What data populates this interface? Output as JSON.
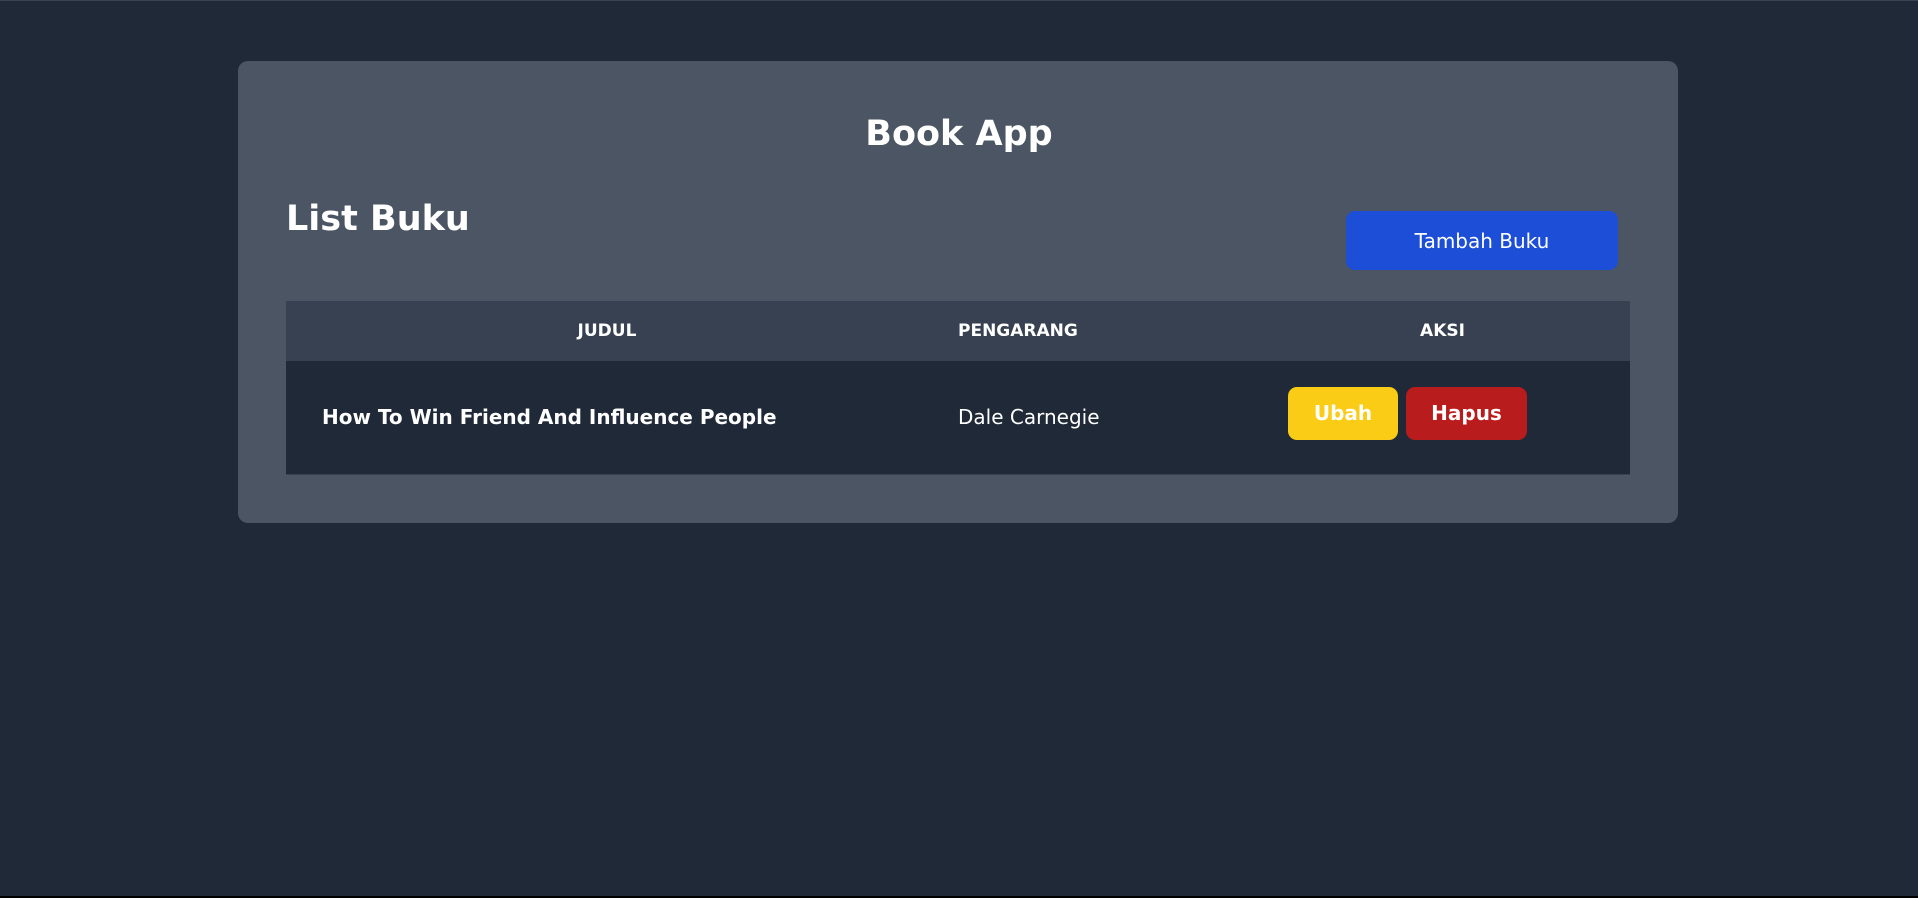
{
  "app": {
    "title": "Book App"
  },
  "list": {
    "title": "List Buku",
    "add_button_label": "Tambah Buku"
  },
  "table": {
    "headers": [
      "Judul",
      "Pengarang",
      "Aksi"
    ],
    "rows": [
      {
        "judul": "How To Win Friend And Influence People",
        "pengarang": "Dale Carnegie",
        "edit_label": "Ubah",
        "delete_label": "Hapus"
      }
    ]
  },
  "colors": {
    "page_background": "#1f2937",
    "card_background": "#4b5563",
    "table_header_background": "#374151",
    "primary_button": "#1d4ed8",
    "edit_button": "#facc15",
    "delete_button": "#b91c1c"
  }
}
